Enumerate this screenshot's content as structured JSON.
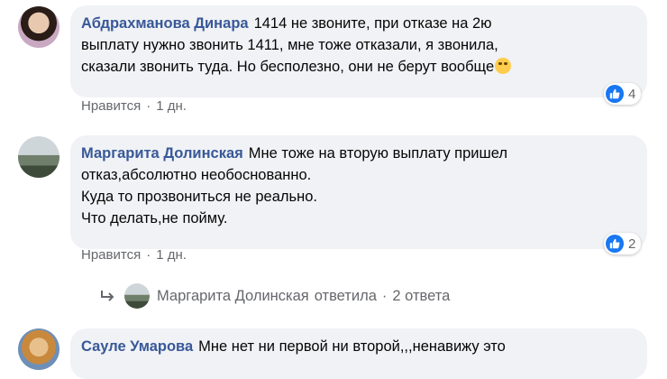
{
  "comments": [
    {
      "author": "Абдрахманова Динара",
      "text": "1414 не звоните, при отказе на 2ю\nвыплату нужно звонить 1411, мне тоже отказали, я звонила,\nсказали звонить туда. Но бесполезно, они не берут вообще",
      "reaction_count": "4",
      "like_label": "Нравится",
      "time": "1 дн."
    },
    {
      "author": "Маргарита Долинская",
      "text": "Мне тоже на вторую выплату пришел\nотказ,абсолютно необоснованно.\nКуда то прозвониться не реально.\nЧто делать,не пойму.",
      "reaction_count": "2",
      "like_label": "Нравится",
      "time": "1 дн.",
      "replies": {
        "author": "Маргарита Долинская",
        "action": "ответила",
        "count_label": "2 ответа"
      }
    },
    {
      "author": "Сауле Умарова",
      "text": "Мне нет ни первой ни второй,,,ненавижу это"
    }
  ],
  "separator": "·",
  "colors": {
    "link": "#385898",
    "bubble": "#f0f2f5",
    "like_blue": "#1877f2",
    "meta": "#65676b"
  }
}
